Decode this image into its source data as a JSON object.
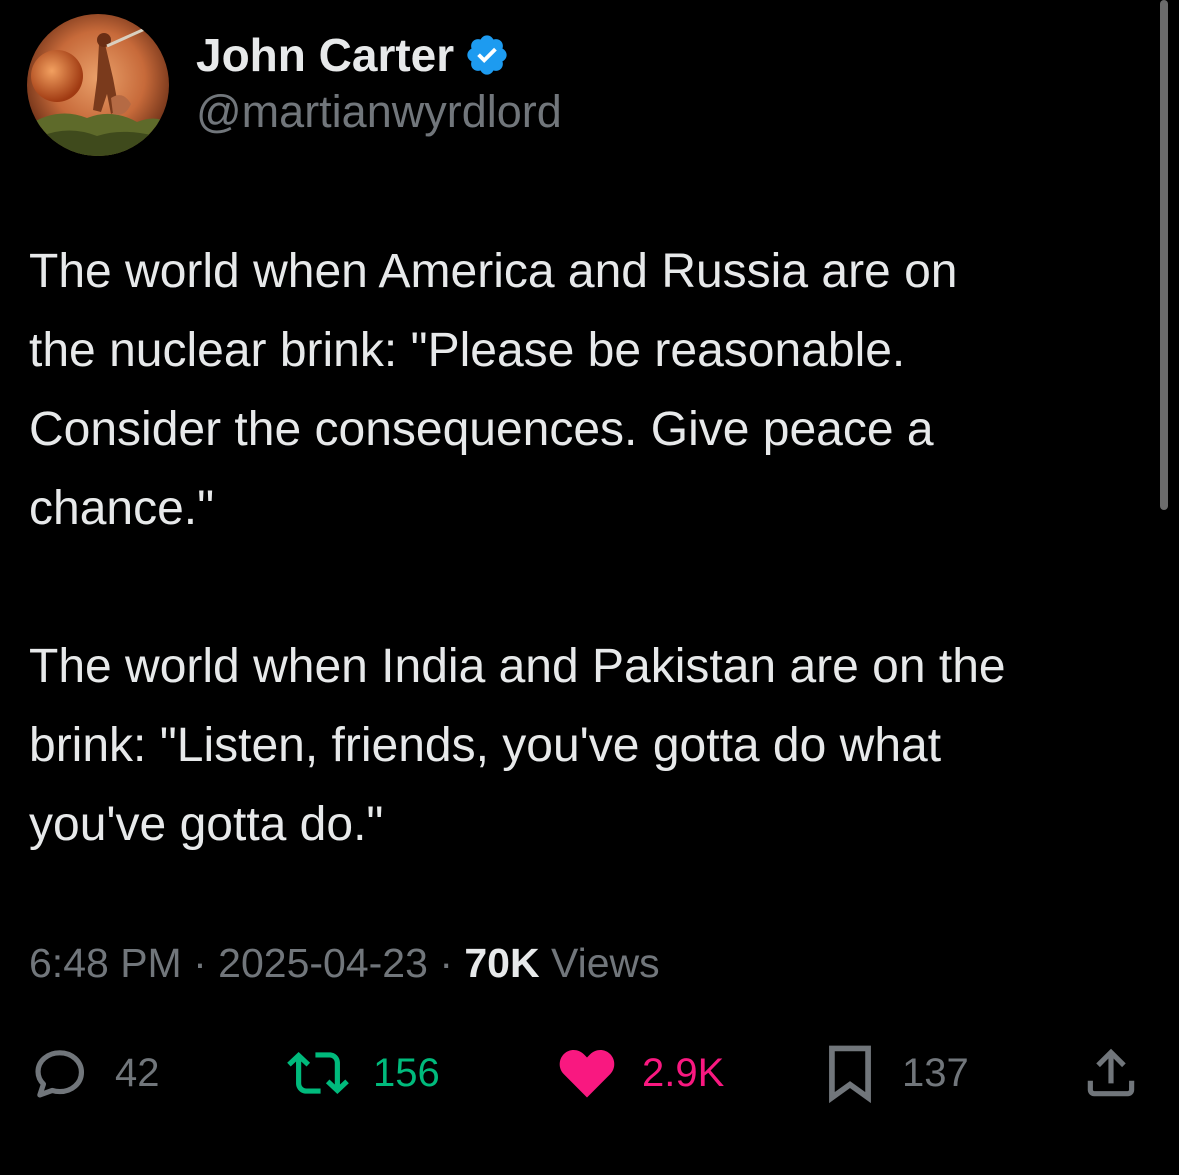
{
  "author": {
    "name": "John Carter",
    "handle": "@martianwyrdlord",
    "verified": true,
    "verified_color": "#1d9bf0"
  },
  "tweet": {
    "paragraphs": [
      "The world when America and Russia are on\nthe nuclear brink: \"Please be reasonable.\nConsider the consequences. Give peace a\nchance.\"",
      "The world when India and Pakistan are on the\nbrink: \"Listen, friends, you've gotta do what\nyou've gotta do.\""
    ]
  },
  "meta": {
    "time": "6:48 PM",
    "separator": "·",
    "date": "2025-04-23",
    "views_count": "70K",
    "views_label": "Views"
  },
  "actions": {
    "reply": {
      "icon": "reply-icon",
      "count": "42",
      "color": "#71767b"
    },
    "repost": {
      "icon": "repost-icon",
      "count": "156",
      "color": "#00ba7c"
    },
    "like": {
      "icon": "heart-icon",
      "count": "2.9K",
      "color": "#f91880",
      "active": true
    },
    "bookmark": {
      "icon": "bookmark-icon",
      "count": "137",
      "color": "#71767b"
    },
    "share": {
      "icon": "share-icon"
    }
  },
  "colors": {
    "background": "#000000",
    "primary_text": "#e7e9ea",
    "secondary_text": "#71767b"
  }
}
